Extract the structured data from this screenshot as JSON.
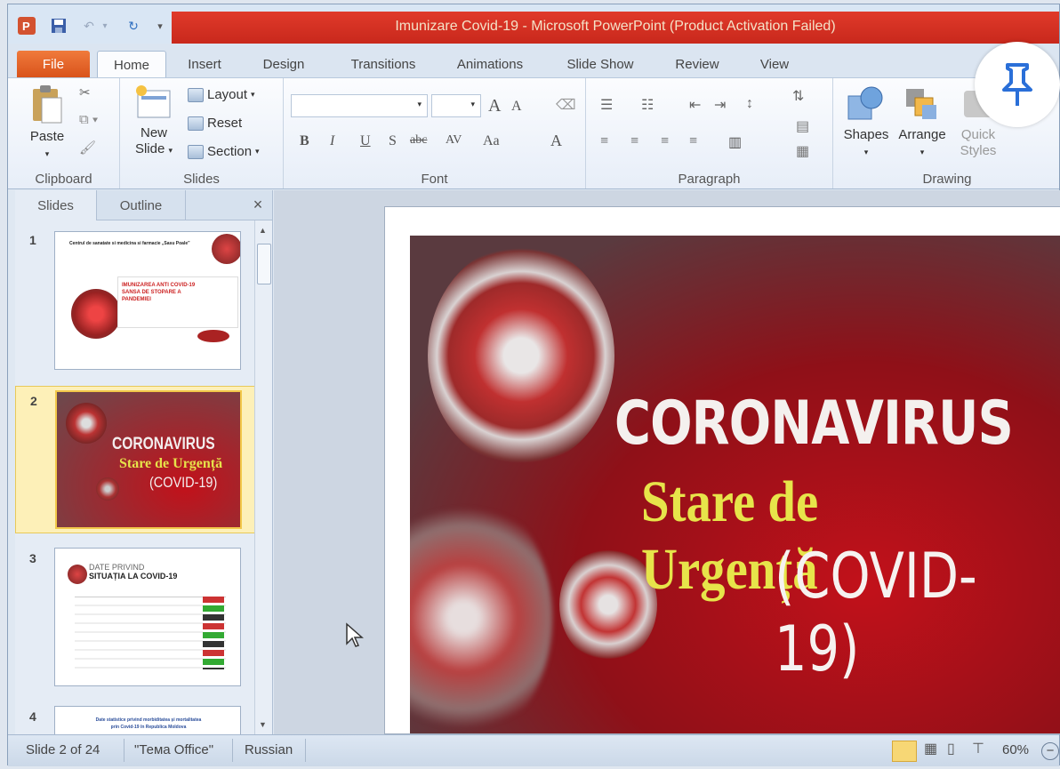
{
  "window": {
    "title": "Imunizare Covid-19  -  Microsoft PowerPoint (Product Activation Failed)"
  },
  "tabs": [
    "File",
    "Home",
    "Insert",
    "Design",
    "Transitions",
    "Animations",
    "Slide Show",
    "Review",
    "View"
  ],
  "active_tab": "Home",
  "ribbon": {
    "clipboard": {
      "paste": "Paste",
      "label": "Clipboard"
    },
    "slides": {
      "new_slide_1": "New",
      "new_slide_2": "Slide",
      "layout": "Layout",
      "reset": "Reset",
      "section": "Section",
      "label": "Slides"
    },
    "font": {
      "label": "Font",
      "bold": "B",
      "italic": "I",
      "underline": "U",
      "shadow": "S",
      "strike": "abc",
      "spacing": "AV",
      "case": "Aa",
      "color": "A",
      "grow": "A",
      "shrink": "A"
    },
    "paragraph": {
      "label": "Paragraph"
    },
    "drawing": {
      "shapes": "Shapes",
      "arrange": "Arrange",
      "quick_1": "Quick",
      "quick_2": "Styles",
      "label": "Drawing"
    }
  },
  "pane": {
    "tabs": [
      "Slides",
      "Outline"
    ],
    "close": "×",
    "thumbs": [
      {
        "num": "1",
        "line1": "Centrul de sanatate si medicina si farmacie „Sasu Poale”",
        "line2": "IMUNIZAREA  ANTI COVID-19",
        "line3": "SANSA DE STOPARE  A",
        "line4": "PANDEMIEI"
      },
      {
        "num": "2",
        "line1": "CORONAVIRUS",
        "line2": "Stare de Urgență",
        "line3": "(COVID-19)"
      },
      {
        "num": "3",
        "line1": "DATE PRIVIND",
        "line2": "SITUAȚIA LA COVID-19"
      },
      {
        "num": "4",
        "line1": "Date statistice privind morbiditatea și mortalitatea",
        "line2": "prin Covid-19 în Republica Moldova"
      }
    ]
  },
  "slide": {
    "line1": "CORONAVIRUS",
    "line2": "Stare de Urgență",
    "line3": "(COVID-19)"
  },
  "status": {
    "slide_info": "Slide 2 of 24",
    "theme": "\"Тема Office\"",
    "language": "Russian",
    "zoom": "60%"
  },
  "colors": {
    "accent_red": "#d42d1f",
    "file_orange": "#e5652b",
    "title_yellow": "#e7e44a"
  }
}
